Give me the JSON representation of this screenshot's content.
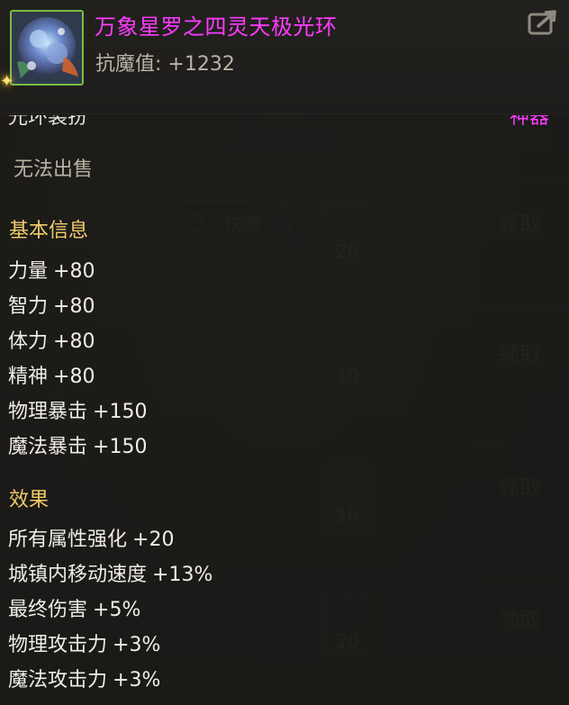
{
  "item": {
    "name": "万象星罗之四灵天极光环",
    "resist_label": "抗魔值:",
    "resist_value": "+1232",
    "type": "光环装扮",
    "rarity": "神器",
    "sell_status": "无法出售"
  },
  "basic_info": {
    "title": "基本信息",
    "stats": [
      {
        "name": "力量",
        "value": "+80"
      },
      {
        "name": "智力",
        "value": "+80"
      },
      {
        "name": "体力",
        "value": "+80"
      },
      {
        "name": "精神",
        "value": "+80"
      },
      {
        "name": "物理暴击",
        "value": "+150"
      },
      {
        "name": "魔法暴击",
        "value": "+150"
      }
    ]
  },
  "effects": {
    "title": "效果",
    "stats": [
      {
        "name": "所有属性强化",
        "value": "+20"
      },
      {
        "name": "城镇内移动速度",
        "value": "+13%"
      },
      {
        "name": "最终伤害",
        "value": "+5%"
      },
      {
        "name": "物理攻击力",
        "value": "+3%"
      },
      {
        "name": "魔法攻击力",
        "value": "+3%"
      }
    ]
  },
  "background": {
    "search_label": "快速",
    "claim_label": "领取",
    "slot_counts": [
      "20",
      "10",
      "10",
      "20"
    ]
  },
  "colors": {
    "name": "#ff3bff",
    "section": "#f2cd6a",
    "icon_border": "#7bbd3f"
  },
  "icons": {
    "share": "share-icon",
    "item": "item-icon",
    "sparkle": "sparkle-icon"
  }
}
